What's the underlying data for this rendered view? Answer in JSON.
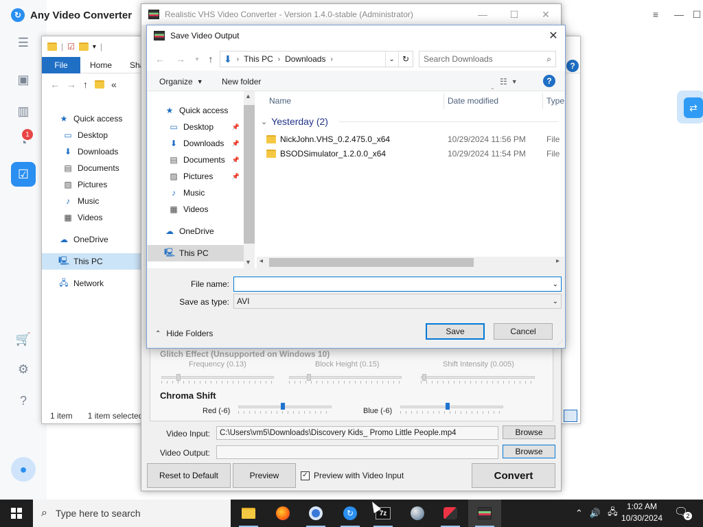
{
  "avc": {
    "title": "Any Video Converter",
    "badge_count": "1"
  },
  "explorer": {
    "ribbon_tabs": [
      "File",
      "Home",
      "Sha"
    ],
    "address_fragment": "«",
    "nav": [
      {
        "label": "Quick access",
        "icon": "star-icon"
      },
      {
        "label": "Desktop",
        "icon": "desktop-icon"
      },
      {
        "label": "Downloads",
        "icon": "download-icon"
      },
      {
        "label": "Documents",
        "icon": "documents-icon"
      },
      {
        "label": "Pictures",
        "icon": "pictures-icon"
      },
      {
        "label": "Music",
        "icon": "music-icon"
      },
      {
        "label": "Videos",
        "icon": "videos-icon"
      },
      {
        "label": "OneDrive",
        "icon": "cloud-icon"
      },
      {
        "label": "This PC",
        "icon": "computer-icon"
      },
      {
        "label": "Network",
        "icon": "network-icon"
      }
    ],
    "status_count": "1 item",
    "status_selected": "1 item selected"
  },
  "vhs": {
    "title": "Realistic VHS Video Converter - Version 1.4.0-stable (Administrator)",
    "glitch": {
      "heading": "Glitch Effect (Unsupported on Windows 10)",
      "frequency": "Frequency (0.13)",
      "block_height": "Block Height (0.15)",
      "shift_intensity": "Shift Intensity (0.005)"
    },
    "chroma": {
      "heading": "Chroma Shift",
      "red": "Red (-6)",
      "blue": "Blue (-6)"
    },
    "video_input_label": "Video Input:",
    "video_input_value": "C:\\Users\\vm5\\Downloads\\Discovery Kids_ Promo Little People.mp4",
    "video_output_label": "Video Output:",
    "video_output_value": "",
    "browse_label": "Browse",
    "reset_label": "Reset to Default",
    "preview_label": "Preview",
    "preview_with_input_label": "Preview with Video Input",
    "preview_with_input_checked": true,
    "convert_label": "Convert"
  },
  "dialog": {
    "title": "Save Video Output",
    "breadcrumb": [
      "This PC",
      "Downloads"
    ],
    "search_placeholder": "Search Downloads",
    "organize_label": "Organize",
    "new_folder_label": "New folder",
    "nav": [
      {
        "label": "Quick access",
        "icon": "star-icon",
        "pinned": false
      },
      {
        "label": "Desktop",
        "icon": "desktop-icon",
        "pinned": true
      },
      {
        "label": "Downloads",
        "icon": "download-icon",
        "pinned": true
      },
      {
        "label": "Documents",
        "icon": "documents-icon",
        "pinned": true
      },
      {
        "label": "Pictures",
        "icon": "pictures-icon",
        "pinned": true
      },
      {
        "label": "Music",
        "icon": "music-icon",
        "pinned": false
      },
      {
        "label": "Videos",
        "icon": "videos-icon",
        "pinned": false
      },
      {
        "label": "OneDrive",
        "icon": "cloud-icon",
        "pinned": false
      },
      {
        "label": "This PC",
        "icon": "computer-icon",
        "pinned": false
      }
    ],
    "columns": {
      "name": "Name",
      "date_modified": "Date modified",
      "type": "Type"
    },
    "group_label": "Yesterday (2)",
    "files": [
      {
        "name": "NickJohn.VHS_0.2.475.0_x64",
        "date": "10/29/2024 11:56 PM",
        "type": "File fo"
      },
      {
        "name": "BSODSimulator_1.2.0.0_x64",
        "date": "10/29/2024 11:54 PM",
        "type": "File fo"
      }
    ],
    "file_name_label": "File name:",
    "file_name_value": "",
    "save_as_type_label": "Save as type:",
    "save_as_type_value": "AVI",
    "hide_folders_label": "Hide Folders",
    "save_label": "Save",
    "cancel_label": "Cancel"
  },
  "taskbar": {
    "search_placeholder": "Type here to search",
    "time": "1:02 AM",
    "date": "10/30/2024",
    "notification_count": "2"
  },
  "colors": {
    "accent": "#0078d7",
    "avc_blue": "#2a8ff0",
    "ribbon_file": "#1f6fc4"
  }
}
